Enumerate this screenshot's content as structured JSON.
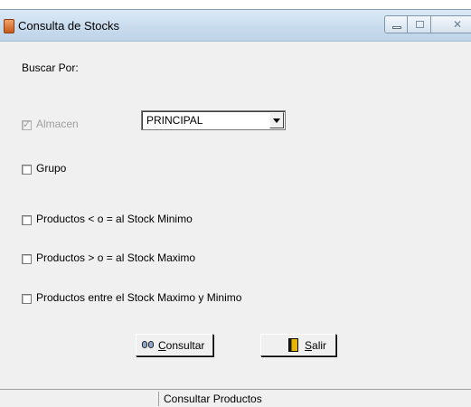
{
  "window": {
    "title": "Consulta de Stocks"
  },
  "form": {
    "search_by_label": "Buscar Por:",
    "almacen": {
      "label": "Almacen",
      "checked": true,
      "enabled": false
    },
    "almacen_combo": {
      "value": "PRINCIPAL"
    },
    "grupo": {
      "label": "Grupo",
      "checked": false
    },
    "stock_minimo": {
      "label": "Productos < o = al Stock Minimo",
      "checked": false
    },
    "stock_maximo": {
      "label": "Productos > o = al Stock Maximo",
      "checked": false
    },
    "stock_entre": {
      "label": "Productos entre el Stock Maximo y Minimo",
      "checked": false
    }
  },
  "buttons": {
    "consultar": {
      "label_first": "C",
      "label_rest": "onsultar",
      "icon": "binoculars-icon"
    },
    "salir": {
      "label_first": "S",
      "label_rest": "alir",
      "icon": "exit-door-icon"
    }
  },
  "statusbar": {
    "text": "Consultar Productos"
  }
}
